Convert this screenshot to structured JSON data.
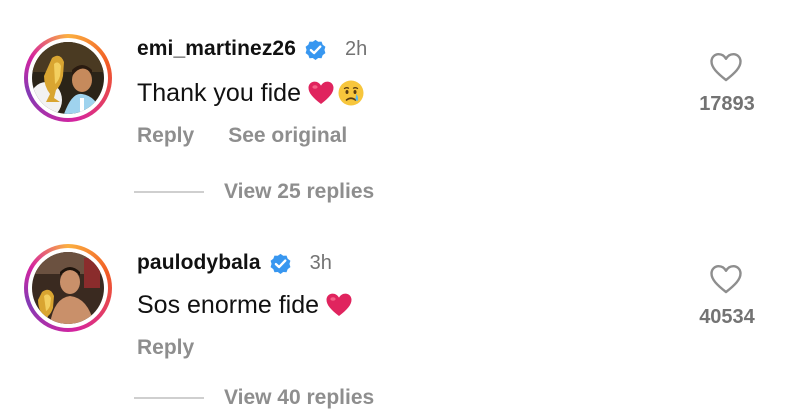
{
  "comments": [
    {
      "username": "emi_martinez26",
      "verified": true,
      "time": "2h",
      "text": "Thank you fide",
      "emojis": [
        "red-heart",
        "crying-face"
      ],
      "actions": [
        "Reply",
        "See original"
      ],
      "likes": "17893",
      "replies_label": "View 25 replies"
    },
    {
      "username": "paulodybala",
      "verified": true,
      "time": "3h",
      "text": "Sos enorme fide",
      "emojis": [
        "red-heart"
      ],
      "actions": [
        "Reply"
      ],
      "likes": "40534",
      "replies_label": "View 40 replies"
    }
  ],
  "colors": {
    "verified_badge": "#3897f0",
    "heart_emoji": "#e0245e",
    "secondary_text": "#8e8e8e",
    "story_ring_start": "#fbb040",
    "story_ring_end": "#d6249f"
  }
}
